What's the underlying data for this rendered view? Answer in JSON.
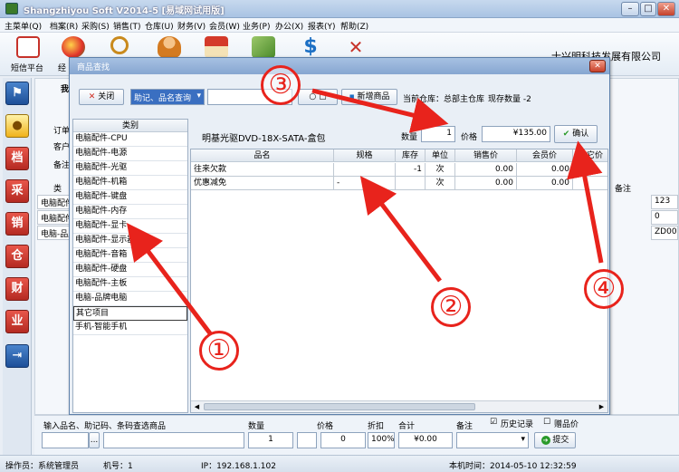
{
  "app": {
    "title": "Shangzhiyou Soft V2014-5 [易域网试用版]"
  },
  "menu": [
    "主菜单(Q)",
    "档案(R)",
    "采购(S)",
    "销售(T)",
    "仓库(U)",
    "财务(V)",
    "会员(W)",
    "业务(P)",
    "办公(X)",
    "报表(Y)",
    "帮助(Z)"
  ],
  "toolbar": {
    "sms_label": "短信平台",
    "second_label": "经",
    "company": "士兴明科技发展有限公司"
  },
  "leftnav": [
    "档",
    "采",
    "销",
    "仓",
    "财",
    "业"
  ],
  "background_form": {
    "tab_fragment": "我",
    "order_label": "订单",
    "customer_label": "客户",
    "note_label": "备注",
    "col_fragment": "类",
    "col_note": "备注",
    "rows": [
      {
        "name": "电脑配件",
        "note": "123"
      },
      {
        "name": "电脑配件",
        "note": "0"
      },
      {
        "name": "电脑-品牌",
        "note": "ZD00"
      }
    ]
  },
  "dialog": {
    "title": "商品查找",
    "close_label": "关闭",
    "search_mode": "助记、品名查询",
    "search_placeholder": "",
    "new_item_label": "新增商品",
    "warehouse_text": "当前仓库：总部主仓库",
    "stock_text": "现存数量 -2",
    "product_name": "明基光驱DVD-18X-SATA-盒包",
    "qty_label": "数量",
    "qty_value": "1",
    "price_label": "价格",
    "price_value": "¥135.00",
    "confirm_label": "确认",
    "category_header": "类别",
    "categories": [
      "电脑配件-CPU",
      "电脑配件-电源",
      "电脑配件-光驱",
      "电脑配件-机箱",
      "电脑配件-键盘",
      "电脑配件-内存",
      "电脑配件-显卡",
      "电脑配件-显示器",
      "电脑配件-音箱",
      "电脑配件-硬盘",
      "电脑配件-主板",
      "电脑-品牌电脑",
      "其它项目",
      "手机-智能手机"
    ],
    "grid_headers": [
      "品名",
      "规格",
      "库存",
      "单位",
      "销售价",
      "会员价",
      "其它价"
    ],
    "grid_rows": [
      {
        "name": "往来欠款",
        "spec": "",
        "stock": "-1",
        "unit": "次",
        "sale": "0.00",
        "member": "0.00",
        "other": ""
      },
      {
        "name": "优惠减免",
        "spec": "-",
        "stock": "",
        "unit": "次",
        "sale": "0.00",
        "member": "0.00",
        "other": ""
      }
    ]
  },
  "bottom": {
    "input_label": "输入品名、助记码、条码查选商品",
    "qty_label": "数量",
    "price_label": "价格",
    "discount_label": "折扣",
    "total_label": "合计",
    "note_label": "备注",
    "history_label": "历史记录",
    "gift_label": "赠品价",
    "qty_value": "1",
    "price_value": "0",
    "discount_value": "100%",
    "total_value": "¥0.00",
    "submit_label": "提交",
    "dots": "..."
  },
  "status": {
    "operator": "操作员：系统管理员",
    "machine": "机号：1",
    "ip": "IP：192.168.1.102",
    "time": "本机时间：2014-05-10 12:32:59"
  },
  "annotations": [
    "①",
    "②",
    "③",
    "④"
  ],
  "colors": {
    "annotation": "#e8231c",
    "title_bar": "#86a6d1",
    "nav_button": "#c9332a"
  }
}
